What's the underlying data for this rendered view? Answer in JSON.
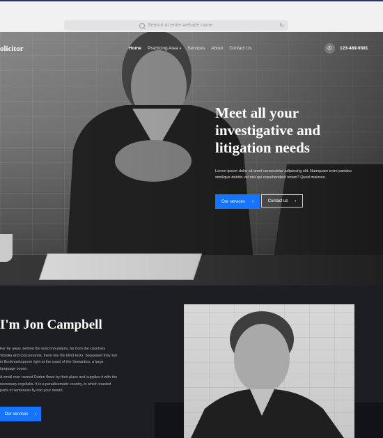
{
  "browser": {
    "address_placeholder": "Search or enter website name"
  },
  "site": {
    "brand": "olicitor",
    "nav": [
      {
        "label": "Home",
        "active": true
      },
      {
        "label": "Practicing Area",
        "has_dropdown": true
      },
      {
        "label": "Services"
      },
      {
        "label": "About"
      },
      {
        "label": "Contact Us"
      }
    ],
    "phone_icon": "phone-icon",
    "phone": "123-489-9381"
  },
  "hero": {
    "title": "Meet all your investigative and litigation needs",
    "text": "Lorem ipsum dolor sit amet consectetur adipiscing elit. Numquam enim pariatur similique debitis vel nisi qui reprehenderit totam? Quod maiores.",
    "btn_services": "Our services",
    "btn_contact": "Contact us",
    "arrow": "›"
  },
  "about": {
    "title": "I'm Jon Campbell",
    "p1": "Far far away, behind the word mountains, far from the countries Vokalia and Consonantia, there live the blind texts. Separated they live in Bookmarksgrove right at the coast of the Semantics, a large language ocean.",
    "p2": "A small river named Duden flows by their place and supplies it with the necessary regelialia. It is a paradisematic country, in which roasted parts of sentences fly into your mouth.",
    "btn_services": "Our services",
    "arrow": "›"
  },
  "colors": {
    "accent": "#1575ff",
    "dark_bg": "#1d1e21"
  }
}
